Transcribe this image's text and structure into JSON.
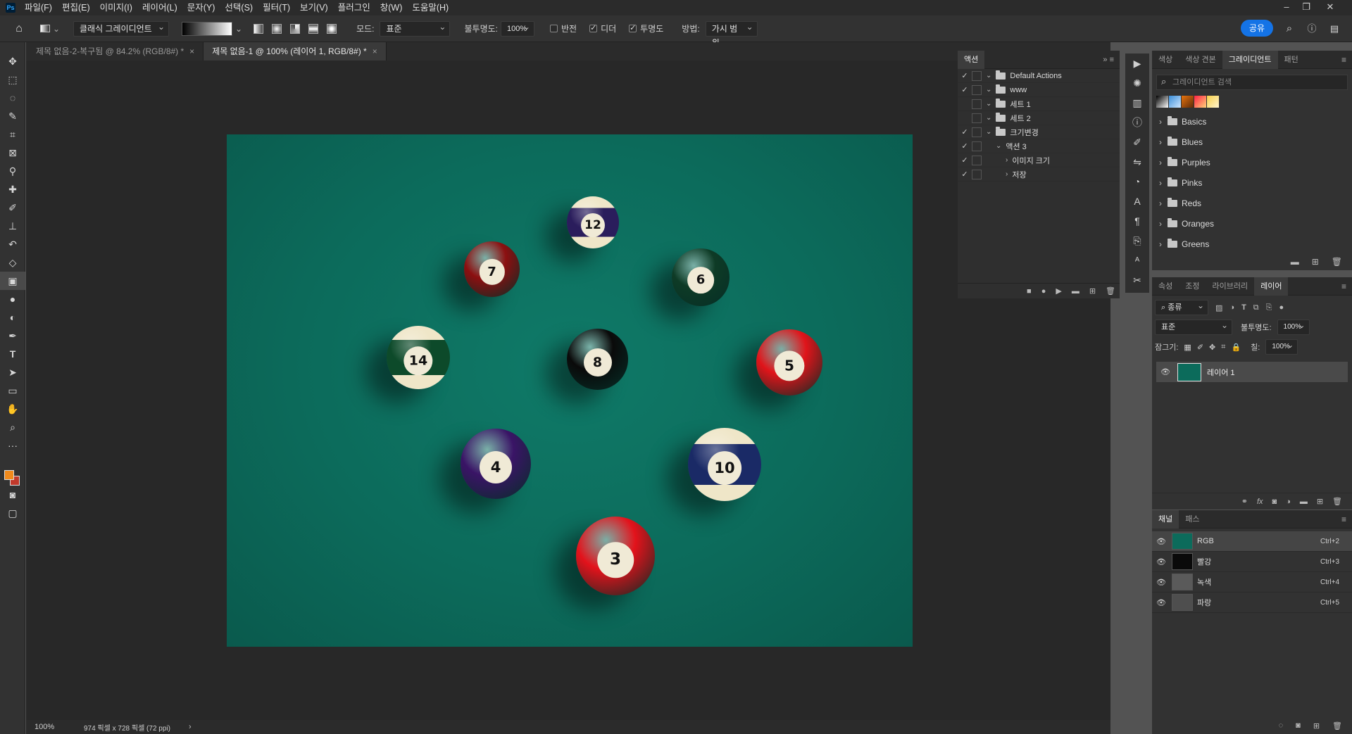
{
  "menubar": {
    "logo": "Ps",
    "items": [
      "파일(F)",
      "편집(E)",
      "이미지(I)",
      "레이어(L)",
      "문자(Y)",
      "선택(S)",
      "필터(T)",
      "보기(V)",
      "플러그인",
      "창(W)",
      "도움말(H)"
    ]
  },
  "options": {
    "gradient_type": "클래식 그레이디언트",
    "mode_label": "모드:",
    "mode_value": "표준",
    "opacity_label": "불투명도:",
    "opacity_value": "100%",
    "reverse_label": "반전",
    "dither_label": "디더",
    "transparency_label": "투명도",
    "method_label": "방법:",
    "method_value": "가시 범위",
    "share_label": "공유"
  },
  "tabs": [
    {
      "label": "제목 없음-2-복구됨 @ 84.2% (RGB/8#) *"
    },
    {
      "label": "제목 없음-1 @ 100% (레이어 1, RGB/8#) *"
    }
  ],
  "canvas": {
    "balls": [
      {
        "number": "12",
        "color": "#2a1d5c",
        "stripe": true
      },
      {
        "number": "7",
        "color": "#8c0f10",
        "stripe": false
      },
      {
        "number": "6",
        "color": "#0e3b26",
        "stripe": false
      },
      {
        "number": "14",
        "color": "#0d4a2a",
        "stripe": true
      },
      {
        "number": "8",
        "color": "#0a0a0a",
        "stripe": false
      },
      {
        "number": "5",
        "color": "#e0141a",
        "stripe": false
      },
      {
        "number": "4",
        "color": "#3a1466",
        "stripe": false
      },
      {
        "number": "10",
        "color": "#1a2a66",
        "stripe": true
      },
      {
        "number": "3",
        "color": "#e3121b",
        "stripe": false
      }
    ]
  },
  "status": {
    "zoom": "100%",
    "doc_info": "974 픽셀 x 728 픽셀 (72 ppi)"
  },
  "actions_panel": {
    "title": "액션",
    "rows": [
      {
        "label": "Default Actions",
        "checked": true,
        "indent": 0,
        "folder": true
      },
      {
        "label": "www",
        "checked": true,
        "indent": 0,
        "folder": true
      },
      {
        "label": "세트 1",
        "checked": false,
        "indent": 0,
        "folder": true
      },
      {
        "label": "세트 2",
        "checked": false,
        "indent": 0,
        "folder": true
      },
      {
        "label": "크기변경",
        "checked": true,
        "indent": 0,
        "folder": true
      },
      {
        "label": "액션 3",
        "checked": true,
        "indent": 1,
        "folder": false
      },
      {
        "label": "이미지 크기",
        "checked": true,
        "indent": 2,
        "folder": false
      },
      {
        "label": "저장",
        "checked": true,
        "indent": 2,
        "folder": false
      }
    ]
  },
  "gradient_panel": {
    "tabs": [
      "색상",
      "색상 견본",
      "그레이디언트",
      "패턴"
    ],
    "search_placeholder": "그레이디언트 검색",
    "folders": [
      "Basics",
      "Blues",
      "Purples",
      "Pinks",
      "Reds",
      "Oranges",
      "Greens"
    ]
  },
  "layers_panel": {
    "tabs": [
      "속성",
      "조정",
      "라이브러리",
      "레이어"
    ],
    "filter_label": "종류",
    "blend_mode": "표준",
    "opacity_label": "불투명도:",
    "opacity_value": "100%",
    "lock_label": "잠그기:",
    "fill_label": "칠:",
    "fill_value": "100%",
    "layer_name": "레이어 1"
  },
  "channels_panel": {
    "tabs": [
      "채널",
      "패스"
    ],
    "channels": [
      {
        "name": "RGB",
        "shortcut": "Ctrl+2"
      },
      {
        "name": "빨강",
        "shortcut": "Ctrl+3"
      },
      {
        "name": "녹색",
        "shortcut": "Ctrl+4"
      },
      {
        "name": "파랑",
        "shortcut": "Ctrl+5"
      }
    ]
  },
  "colors": {
    "foreground": "#f08a1c",
    "background": "#c0392b",
    "accent": "#1473e6"
  }
}
